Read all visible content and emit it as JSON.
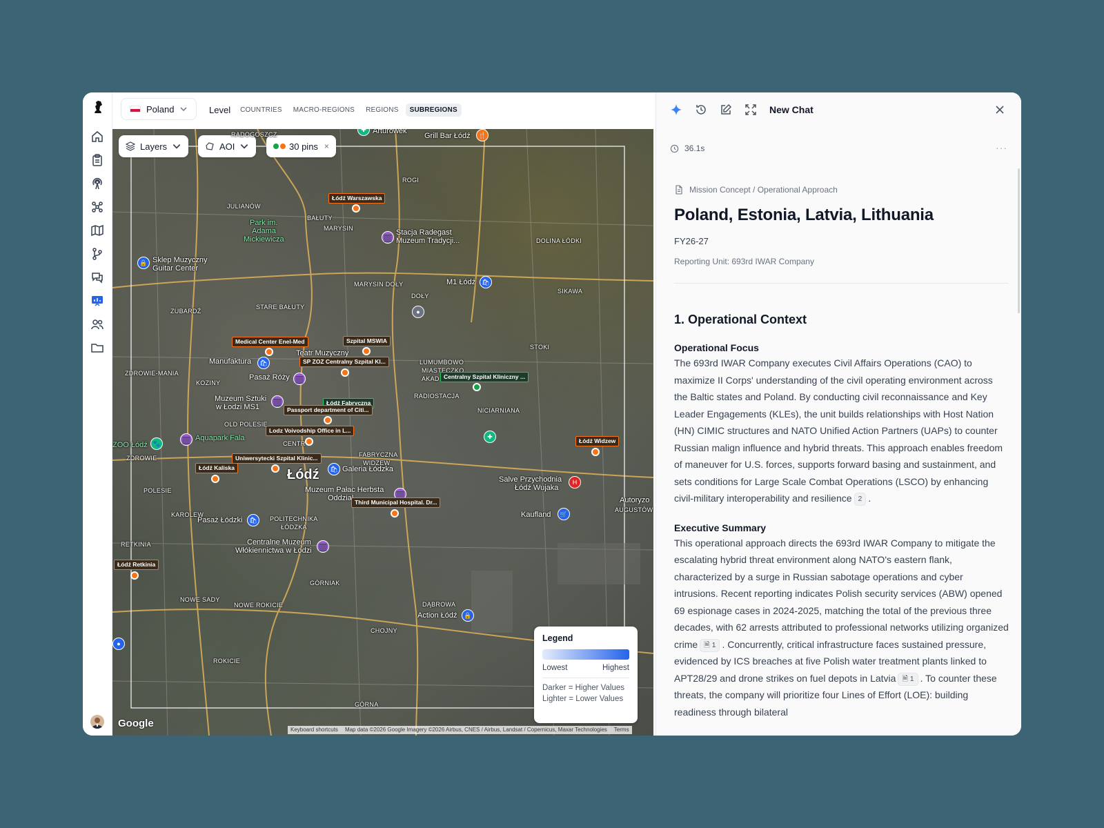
{
  "topbar": {
    "country": "Poland",
    "level_label": "Level",
    "levels": [
      "COUNTRIES",
      "MACRO-REGIONS",
      "REGIONS",
      "SUBREGIONS"
    ]
  },
  "map": {
    "controls": {
      "layers": "Layers",
      "aoi": "AOI",
      "pins": "30 pins",
      "pins_close": "×"
    },
    "pins": [
      "Łódź Warszawska",
      "Medical Center Enel-Med",
      "Szpital MSWIA",
      "SP ZOZ Centralny Szpital Kl...",
      "Centralny Szpital Kliniczny ...",
      "Łódź Fabryczna",
      "Passport department of Citi...",
      "Lodz Voivodship Office in L...",
      "Uniwersytecki Szpital Klinic...",
      "Łódź Kaliska",
      "Third Municipal Hospital. Dr...",
      "Łódź Widzew",
      "Łódź Retkinia"
    ],
    "places": {
      "julianow": "JULIANÓW",
      "marysin": "MARYSIN",
      "baluty": "BAŁUTY",
      "marysin_doly": "MARYSIN DOŁY",
      "stare_baluty": "STARE BAŁUTY",
      "zubardz": "ZUBARDŹ",
      "doly": "DOŁY",
      "dolina_lodki": "DOLINA ŁÓDKI",
      "sikawa": "SIKAWA",
      "stoki": "STOKI",
      "lumumbowo": "LUMUMBOWO",
      "miasteczko": "MIASTECZKO",
      "akad": "AKAD",
      "radiostacja": "RADIOSTACJA",
      "niciarniana": "NICIARNIANA",
      "koziny": "KOZINY",
      "zdrowie_mania": "ZDROWIE-MANIA",
      "old_polesie": "OLD POLESIE",
      "centr": "CENTR",
      "fabryczna": "FABRYCZNA",
      "widzew": "WIDZEW",
      "zdrowie": "ZDROWIE",
      "polesie": "POLESIE",
      "karolew": "KAROLEW",
      "politechnika": "POLITECHNIKA",
      "lodzka": "ŁÓDZKA",
      "retkinia": "RETKINIA",
      "gorniak": "GÓRNIAK",
      "nowe_sady": "NOWE SADY",
      "nowe_rokicie": "NOWE ROKICIE",
      "dabrowa": "DĄBROWA",
      "chojny": "CHOJNY",
      "rokicie": "ROKICIE",
      "gorna": "GÓRNA",
      "radogoszcz": "RADOGOSZCZ",
      "rogi": "ROGI",
      "augustow": "AUGUSTÓW",
      "lodz": "Łódź"
    },
    "pois": {
      "arturowek": "Arturówek",
      "grill_bar": "Grill Bar Łódź",
      "park_line1": "Park im.",
      "park_line2": "Adama",
      "park_line3": "Mickiewicza",
      "sklep_line1": "Sklep Muzyczny",
      "sklep_line2": "Guitar Center",
      "stacja_line1": "Stacja Radegast",
      "stacja_line2": "Muzeum Tradycji...",
      "m1": "M1 Łódź",
      "teatr": "Teatr Muzyczny",
      "manufaktura": "Manufaktura",
      "pasaz_rozy": "Pasaż Róży",
      "muzeum_sztuki_line1": "Muzeum Sztuki",
      "muzeum_sztuki_line2": "w Łodzi MS1",
      "aquapark": "Aquapark Fala",
      "zoo": "ZOO Łódź",
      "galeria": "Galeria Łódzka",
      "muzeum_palac_line1": "Muzeum Pałac Herbsta",
      "muzeum_palac_line2": "Oddział",
      "salve_line1": "Salve Przychodnia",
      "salve_line2": "Łódź Wujaka",
      "kaufland": "Kaufland",
      "pasaz_lodzki": "Pasaż Łódzki",
      "centralne_line1": "Centralne Muzeum",
      "centralne_line2": "Włókiennictwa w Łodzi",
      "action": "Action Łódź",
      "autoryzo": "Autoryzo"
    },
    "legend": {
      "title": "Legend",
      "low": "Lowest",
      "high": "Highest",
      "note1": "Darker = Higher Values",
      "note2": "Lighter = Lower Values"
    },
    "attribution": {
      "brand": "Google",
      "shortcuts": "Keyboard shortcuts",
      "data": "Map data ©2026 Google Imagery ©2026 Airbus, CNES / Airbus, Landsat / Copernicus, Maxar Technologies",
      "terms": "Terms"
    }
  },
  "chat": {
    "title": "New Chat",
    "timing": "36.1s",
    "more": "···",
    "doc": {
      "breadcrumb": "Mission Concept / Operational Approach",
      "title": "Poland, Estonia, Latvia, Lithuania",
      "fy": "FY26-27",
      "unit": "Reporting Unit: 693rd IWAR Company",
      "section1": "1. Operational Context",
      "focus_heading": "Operational Focus",
      "focus_text": "The 693rd IWAR Company executes Civil Affairs Operations (CAO) to maximize II Corps' understanding of the civil operating environment across the Baltic states and Poland. By conducting civil reconnaissance and Key Leader Engagements (KLEs), the unit builds relationships with Host Nation (HN) CIMIC structures and NATO Unified Action Partners (UAPs) to counter Russian malign influence and hybrid threats. This approach enables freedom of maneuver for U.S. forces, supports forward basing and sustainment, and sets conditions for Large Scale Combat Operations (LSCO) by enhancing civil-military interoperability and resilience",
      "focus_cite": "2",
      "focus_end": ".",
      "exec_heading": "Executive Summary",
      "exec_text1": "This operational approach directs the 693rd IWAR Company to mitigate the escalating hybrid threat environment along NATO's eastern flank, characterized by a surge in Russian sabotage operations and cyber intrusions. Recent reporting indicates Polish security services (ABW) opened 69 espionage cases in 2024-2025, matching the total of the previous three decades, with 62 arrests attributed to professional networks utilizing organized crime",
      "exec_cite1": "1",
      "exec_text2": ". Concurrently, critical infrastructure faces sustained pressure, evidenced by ICS breaches at five Polish water treatment plants linked to APT28/29 and drone strikes on fuel depots in Latvia",
      "exec_cite2": "1",
      "exec_text3": ". To counter these threats, the company will prioritize four Lines of Effort (LOE): building readiness through bilateral"
    }
  },
  "colors": {
    "accent": "#2563eb",
    "pin_orange": "#f97316",
    "pin_green": "#16a34a",
    "poi_purple": "#9b59d0"
  }
}
